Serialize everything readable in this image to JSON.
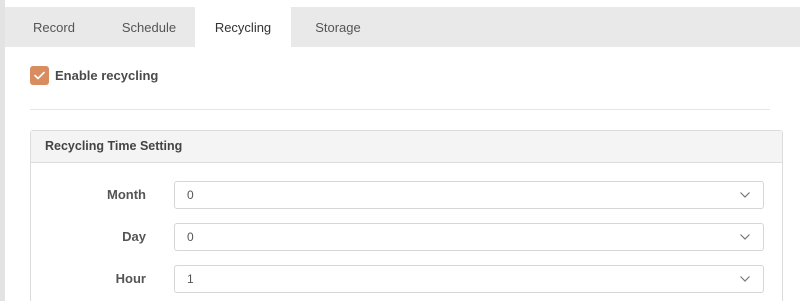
{
  "tabs": [
    {
      "label": "Record",
      "active": false
    },
    {
      "label": "Schedule",
      "active": false
    },
    {
      "label": "Recycling",
      "active": true
    },
    {
      "label": "Storage",
      "active": false
    }
  ],
  "enable_recycling": {
    "label": "Enable recycling",
    "checked": true
  },
  "panel": {
    "title": "Recycling Time Setting",
    "fields": [
      {
        "label": "Month",
        "value": "0"
      },
      {
        "label": "Day",
        "value": "0"
      },
      {
        "label": "Hour",
        "value": "1"
      }
    ]
  },
  "colors": {
    "accent": "#d98c5f",
    "tabbar": "#e9e9e9",
    "panel_header": "#f4f4f4"
  },
  "icons": {
    "checkbox": "checkmark-icon",
    "select": "chevron-down-icon"
  }
}
